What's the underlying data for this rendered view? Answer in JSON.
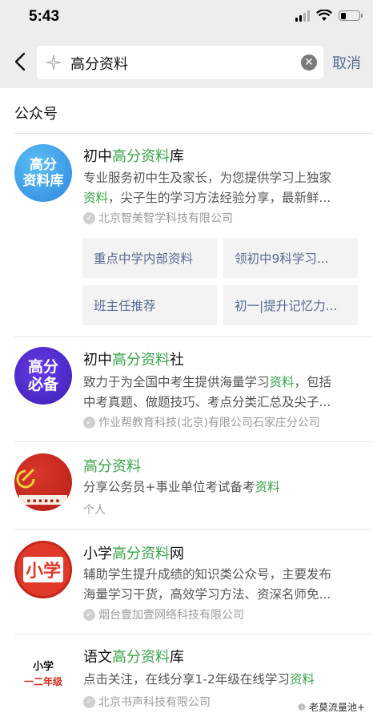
{
  "status": {
    "time": "5:43"
  },
  "search": {
    "query": "高分资料",
    "cancel_label": "取消"
  },
  "section_title": "公众号",
  "accounts": [
    {
      "name_pre": "初中",
      "name_hl": "高分资料",
      "name_post": "库",
      "avatar_text_1": "高分",
      "avatar_text_2": "资料库",
      "desc_line1_a": "专业服务初中生及家长，为您提供学习上独家",
      "desc_line2_hl": "资料",
      "desc_line2_b": "，尖子生的学习方法经验分享，最新鲜...",
      "org": "北京智美智学科技有限公司",
      "menus": [
        "重点中学内部资料",
        "领初中9科学习...",
        "班主任推荐",
        "初一|提升记忆力..."
      ]
    },
    {
      "name_pre": "初中",
      "name_hl": "高分资料",
      "name_post": "社",
      "avatar_text_1": "高分",
      "avatar_text_2": "必备",
      "desc_line1_a": "致力于为全国中考生提供海量学习",
      "desc_line1_hl": "资料",
      "desc_line1_b": "，包括",
      "desc_line2_b": "中考真题、做题技巧、考点分类汇总及尖子...",
      "org": "作业帮教育科技(北京)有限公司石家庄分公司"
    },
    {
      "name_hl": "高分资料",
      "desc_line1_a": "分享公务员+事业单位考试备考",
      "desc_line1_hl": "资料",
      "org": "个人"
    },
    {
      "name_pre": "小学",
      "name_hl": "高分资料",
      "name_post": "网",
      "avatar_text_1": "小学",
      "desc_line1_a": "辅助学生提升成绩的知识类公众号，主要发布",
      "desc_line2_b": "海量学习干货，高效学习方法、资深名师免...",
      "org": "烟台壹加壹网络科技有限公司"
    },
    {
      "name_pre": "语文",
      "name_hl": "高分资料",
      "name_post": "库",
      "avatar_text_1": "小学",
      "avatar_text_2": "一二年级",
      "desc_line1_a": "点击关注，在线分享1-2年级在线学习",
      "desc_line1_hl": "资料",
      "org": "北京书声科技有限公司"
    }
  ],
  "watermark": "老莫流量池+"
}
